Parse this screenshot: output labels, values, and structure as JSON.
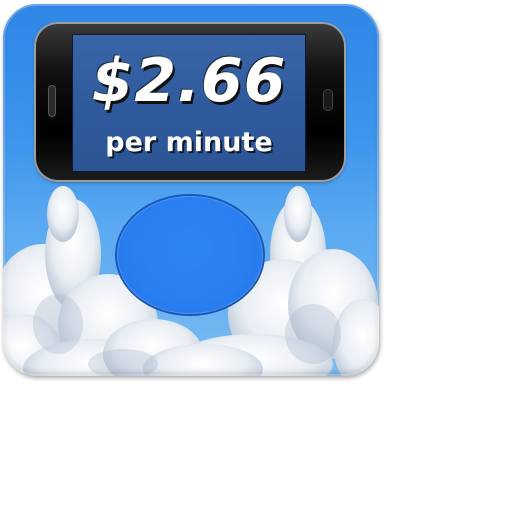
{
  "icon": {
    "price_text": "$2.66",
    "rate_unit_text": "per minute"
  },
  "colors": {
    "icon_background": "#3d94ec",
    "screen": "#2f5b9e",
    "button": "#2a7ff0",
    "text": "#ffffff"
  }
}
